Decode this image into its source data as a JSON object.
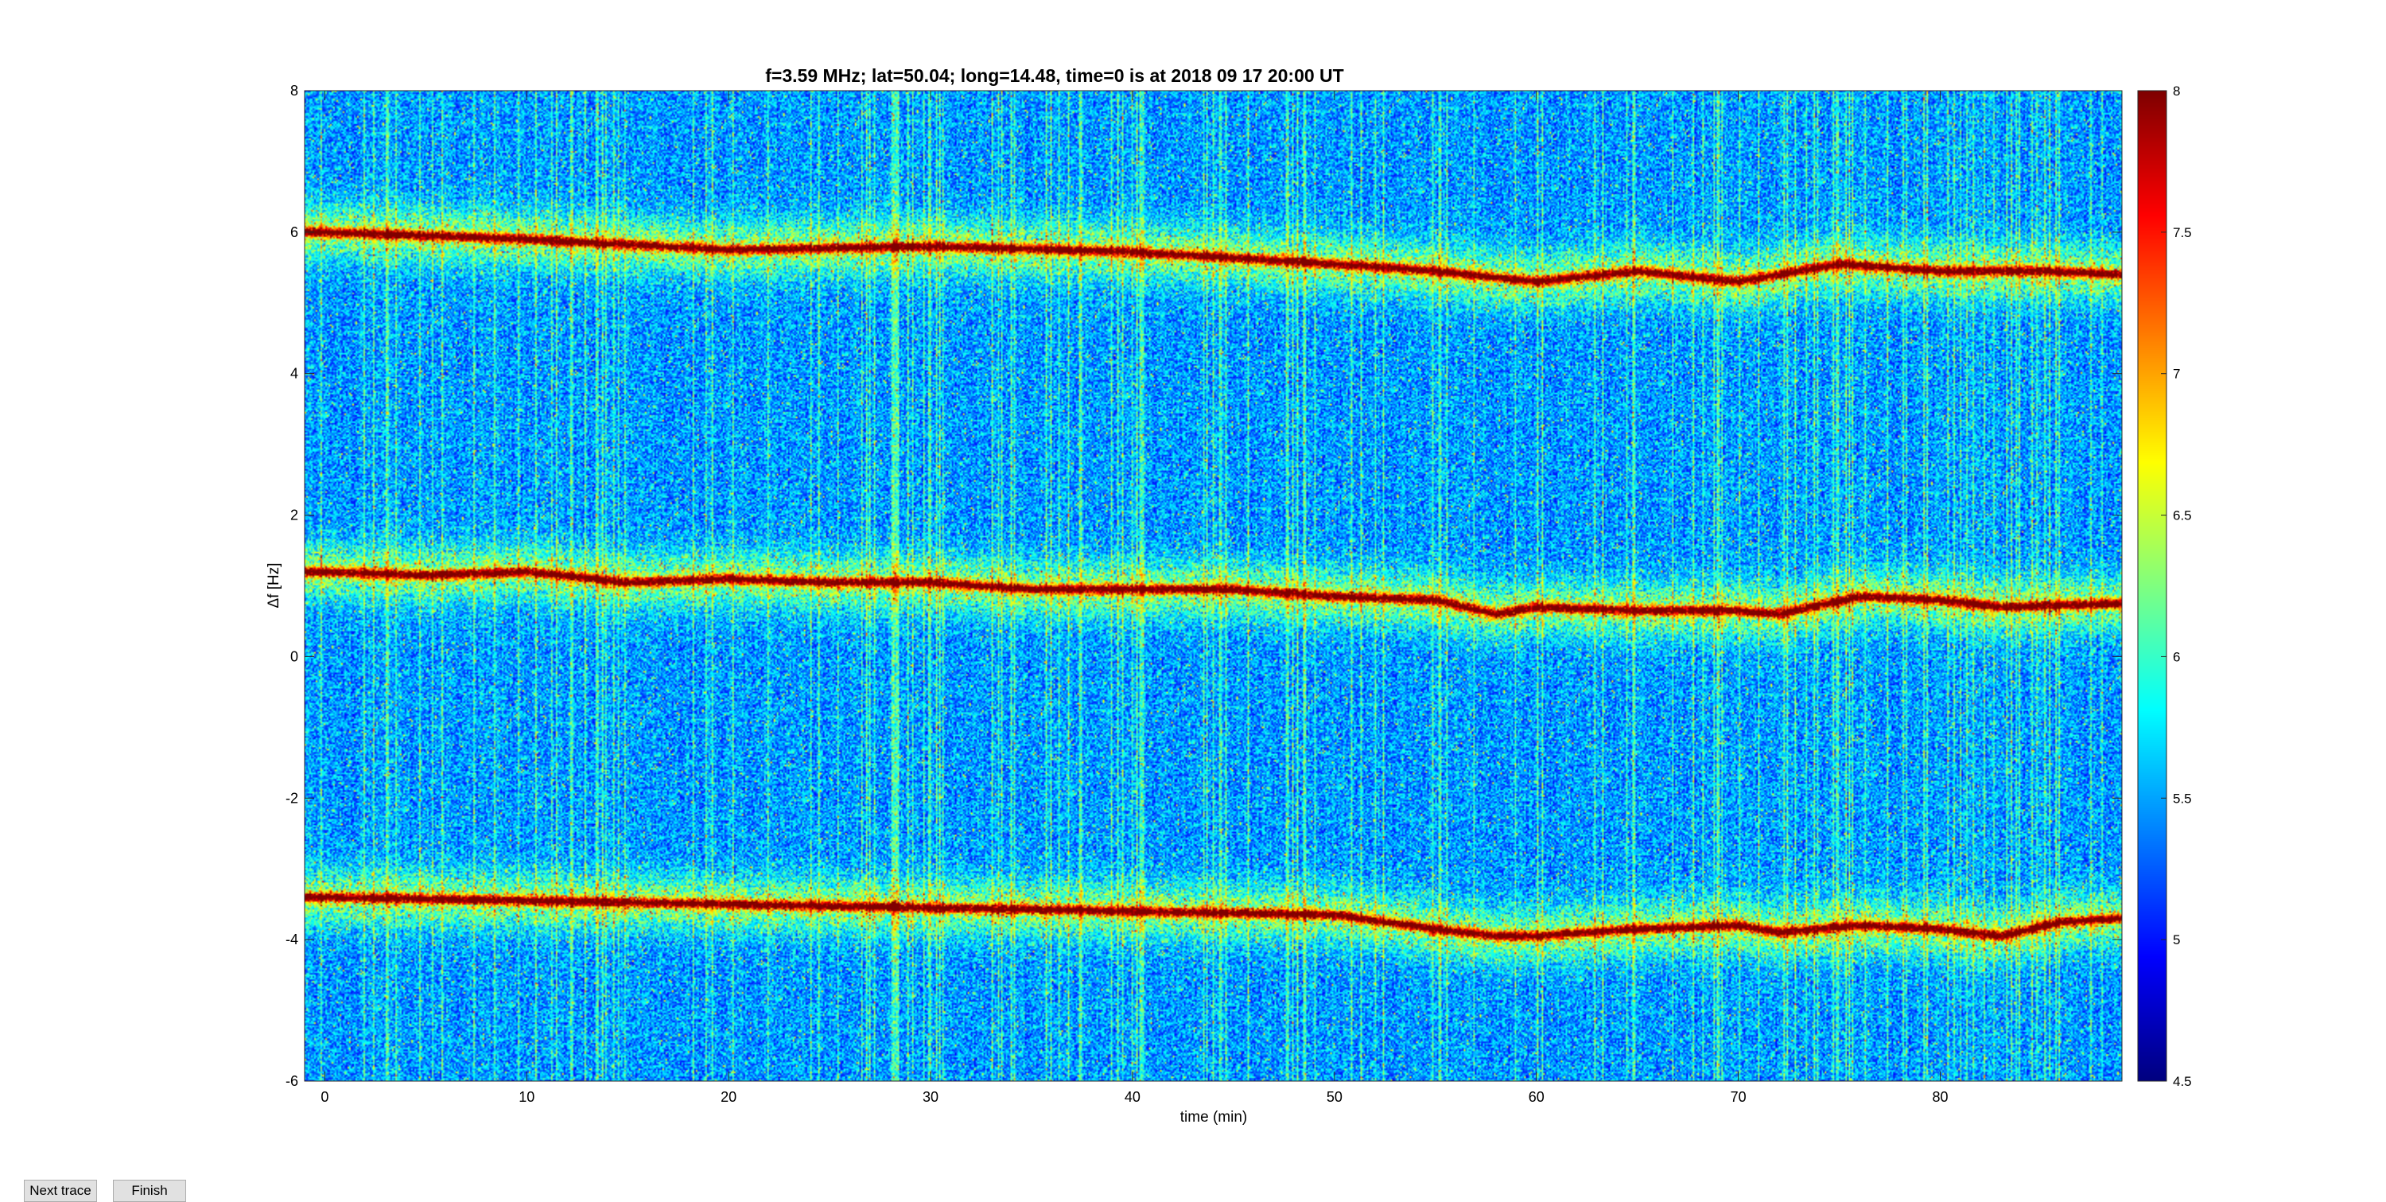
{
  "window": {
    "buttons": [
      {
        "label": "Next trace"
      },
      {
        "label": "Finish"
      }
    ]
  },
  "chart_data": {
    "type": "heatmap",
    "title": "f=3.59 MHz;  lat=50.04; long=14.48, time=0 is at 2018 09 17 20:00 UT",
    "xlabel": "time (min)",
    "ylabel": "Δf [Hz]",
    "xlim": [
      -1,
      89
    ],
    "ylim": [
      -6,
      8
    ],
    "xticks": [
      0,
      10,
      20,
      30,
      40,
      50,
      60,
      70,
      80
    ],
    "yticks": [
      -6,
      -4,
      -2,
      0,
      2,
      4,
      6,
      8
    ],
    "colormap": "jet",
    "clim": [
      4.5,
      8
    ],
    "colorbar_ticks": [
      4.5,
      5,
      5.5,
      6,
      6.5,
      7,
      7.5,
      8
    ],
    "traces": [
      {
        "t": [
          0,
          10,
          20,
          30,
          40,
          50,
          55,
          60,
          65,
          70,
          75,
          80,
          85,
          89
        ],
        "df": [
          6.0,
          5.9,
          5.75,
          5.8,
          5.72,
          5.55,
          5.45,
          5.3,
          5.45,
          5.3,
          5.55,
          5.45,
          5.45,
          5.4
        ]
      },
      {
        "t": [
          0,
          5,
          10,
          15,
          20,
          25,
          30,
          35,
          40,
          45,
          50,
          55,
          58,
          60,
          65,
          70,
          72,
          76,
          80,
          83,
          89
        ],
        "df": [
          1.2,
          1.15,
          1.2,
          1.05,
          1.1,
          1.05,
          1.05,
          0.95,
          0.95,
          0.95,
          0.85,
          0.8,
          0.6,
          0.7,
          0.65,
          0.65,
          0.6,
          0.85,
          0.8,
          0.7,
          0.75
        ]
      },
      {
        "t": [
          0,
          10,
          20,
          30,
          40,
          50,
          55,
          58,
          60,
          65,
          70,
          72,
          76,
          80,
          83,
          86,
          89
        ],
        "df": [
          -3.4,
          -3.45,
          -3.5,
          -3.55,
          -3.6,
          -3.65,
          -3.85,
          -3.95,
          -3.95,
          -3.85,
          -3.8,
          -3.9,
          -3.8,
          -3.85,
          -3.95,
          -3.75,
          -3.7
        ]
      }
    ]
  }
}
